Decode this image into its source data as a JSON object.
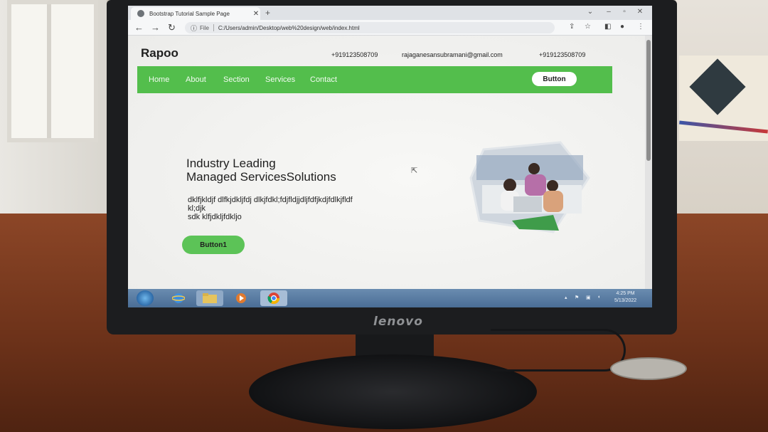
{
  "browser": {
    "tab_title": "Bootstrap Tutorial Sample Page",
    "protocol_label": "File",
    "url": "C:/Users/admin/Desktop/web%20design/web/index.html"
  },
  "site": {
    "logo": "Rapoo",
    "phone_1": "+919123508709",
    "email": "rajaganesansubramani@gmail.com",
    "phone_2": "+919123508709",
    "nav_items": [
      "Home",
      "About",
      "Section",
      "Services",
      "Contact"
    ],
    "nav_button": "Button",
    "hero_title_line1": "Industry Leading",
    "hero_title_line2": "Managed ServicesSolutions",
    "hero_text_line1": "dklfjkldjf dlfkjdkljfdj dlkjfdkl;fdjfldjjdljfdfjkdjfdlkjfldf",
    "hero_text_line2": "kl;djk",
    "hero_text_line3": "sdk klfjdkljfdkljo",
    "hero_button": "Button1"
  },
  "taskbar": {
    "clock_time": "4:25 PM",
    "clock_date": "5/13/2022"
  },
  "monitor": {
    "brand": "lenovo"
  },
  "colors": {
    "navbar_green": "#53be4c",
    "button_green": "#5cc357"
  }
}
